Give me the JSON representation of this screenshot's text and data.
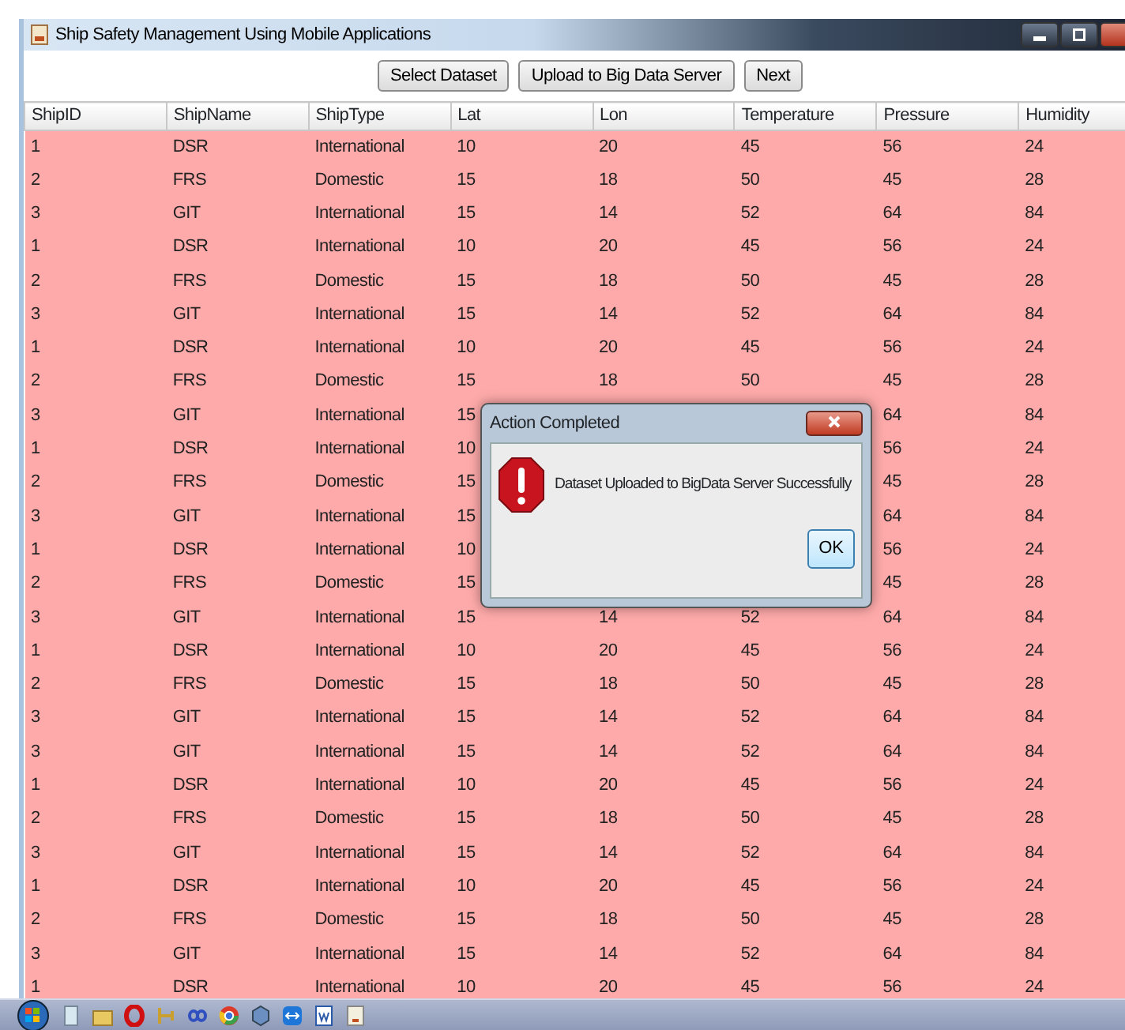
{
  "window": {
    "title": "Ship Safety Management Using Mobile Applications"
  },
  "toolbar": {
    "buttons": [
      "Select Dataset",
      "Upload to Big Data Server",
      "Next"
    ]
  },
  "table": {
    "columns": [
      "ShipID",
      "ShipName",
      "ShipType",
      "Lat",
      "Lon",
      "Temperature",
      "Pressure",
      "Humidity"
    ],
    "rows": [
      [
        "1",
        "DSR",
        "International",
        "10",
        "20",
        "45",
        "56",
        "24"
      ],
      [
        "2",
        "FRS",
        "Domestic",
        "15",
        "18",
        "50",
        "45",
        "28"
      ],
      [
        "3",
        "GIT",
        "International",
        "15",
        "14",
        "52",
        "64",
        "84"
      ],
      [
        "1",
        "DSR",
        "International",
        "10",
        "20",
        "45",
        "56",
        "24"
      ],
      [
        "2",
        "FRS",
        "Domestic",
        "15",
        "18",
        "50",
        "45",
        "28"
      ],
      [
        "3",
        "GIT",
        "International",
        "15",
        "14",
        "52",
        "64",
        "84"
      ],
      [
        "1",
        "DSR",
        "International",
        "10",
        "20",
        "45",
        "56",
        "24"
      ],
      [
        "2",
        "FRS",
        "Domestic",
        "15",
        "18",
        "50",
        "45",
        "28"
      ],
      [
        "3",
        "GIT",
        "International",
        "15",
        null,
        null,
        "64",
        "84"
      ],
      [
        "1",
        "DSR",
        "International",
        "10",
        null,
        null,
        "56",
        "24"
      ],
      [
        "2",
        "FRS",
        "Domestic",
        "15",
        null,
        null,
        "45",
        "28"
      ],
      [
        "3",
        "GIT",
        "International",
        "15",
        null,
        null,
        "64",
        "84"
      ],
      [
        "1",
        "DSR",
        "International",
        "10",
        null,
        null,
        "56",
        "24"
      ],
      [
        "2",
        "FRS",
        "Domestic",
        "15",
        null,
        null,
        "45",
        "28"
      ],
      [
        "3",
        "GIT",
        "International",
        "15",
        "14",
        "52",
        "64",
        "84"
      ],
      [
        "1",
        "DSR",
        "International",
        "10",
        "20",
        "45",
        "56",
        "24"
      ],
      [
        "2",
        "FRS",
        "Domestic",
        "15",
        "18",
        "50",
        "45",
        "28"
      ],
      [
        "3",
        "GIT",
        "International",
        "15",
        "14",
        "52",
        "64",
        "84"
      ],
      [
        "3",
        "GIT",
        "International",
        "15",
        "14",
        "52",
        "64",
        "84"
      ],
      [
        "1",
        "DSR",
        "International",
        "10",
        "20",
        "45",
        "56",
        "24"
      ],
      [
        "2",
        "FRS",
        "Domestic",
        "15",
        "18",
        "50",
        "45",
        "28"
      ],
      [
        "3",
        "GIT",
        "International",
        "15",
        "14",
        "52",
        "64",
        "84"
      ],
      [
        "1",
        "DSR",
        "International",
        "10",
        "20",
        "45",
        "56",
        "24"
      ],
      [
        "2",
        "FRS",
        "Domestic",
        "15",
        "18",
        "50",
        "45",
        "28"
      ],
      [
        "3",
        "GIT",
        "International",
        "15",
        "14",
        "52",
        "64",
        "84"
      ],
      [
        "1",
        "DSR",
        "International",
        "10",
        "20",
        "45",
        "56",
        "24"
      ]
    ]
  },
  "dialog": {
    "title": "Action Completed",
    "message": "Dataset Uploaded to BigData Server Successfully",
    "button": "OK"
  }
}
